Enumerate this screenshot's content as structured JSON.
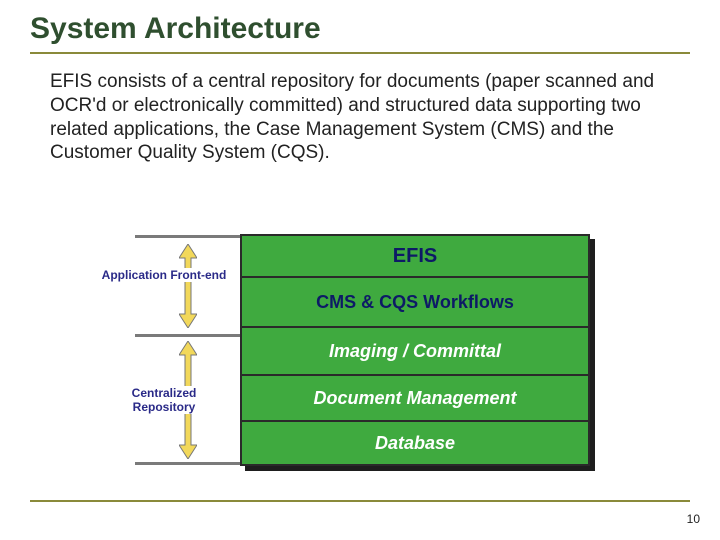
{
  "title": "System Architecture",
  "body": "EFIS consists of a central repository for documents (paper scanned and OCR'd or electronically committed) and structured data supporting two related applications, the Case Management System (CMS) and the Customer Quality System (CQS).",
  "page_number": "10",
  "diagram": {
    "left_labels": {
      "top": "Application Front-end",
      "bottom": "Centralized Repository"
    },
    "stack": {
      "row1": "EFIS",
      "row2": "CMS & CQS Workflows",
      "row3": "Imaging / Committal",
      "row4": "Document Management",
      "row5": "Database"
    }
  },
  "chart_data": {
    "type": "diagram",
    "title": "System Architecture",
    "groups": [
      {
        "label": "Application Front-end",
        "layers": [
          "EFIS",
          "CMS & CQS Workflows"
        ]
      },
      {
        "label": "Centralized Repository",
        "layers": [
          "Imaging / Committal",
          "Document Management",
          "Database"
        ]
      }
    ]
  }
}
